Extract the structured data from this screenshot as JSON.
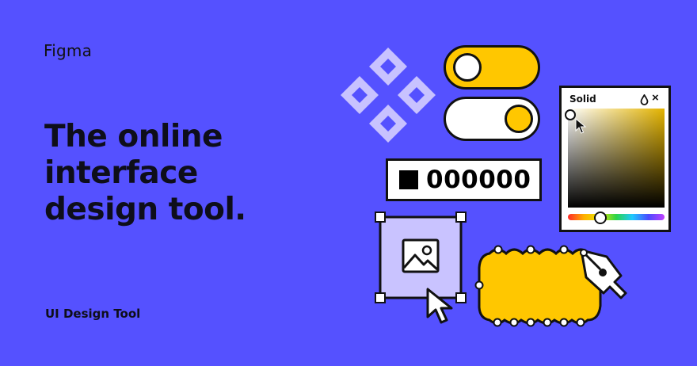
{
  "brand": "Figma",
  "headline": {
    "line1": "The online",
    "line2": "interface",
    "line3": "design tool."
  },
  "footer_label": "UI Design Tool",
  "hex_field": {
    "value": "000000",
    "swatch_color": "#000000"
  },
  "color_picker": {
    "mode_label": "Solid",
    "close_symbol": "×"
  },
  "icons": [
    "components-diamond-icon",
    "toggle-on",
    "toggle-off",
    "image-icon",
    "cursor-icon",
    "pen-tool-icon",
    "opacity-drop-icon",
    "close-icon"
  ],
  "colors": {
    "background": "#5551ff",
    "accent_yellow": "#ffc700",
    "diamond": "#c8c2ff",
    "frame_fill": "#c9c3ff",
    "ink": "#111111"
  }
}
